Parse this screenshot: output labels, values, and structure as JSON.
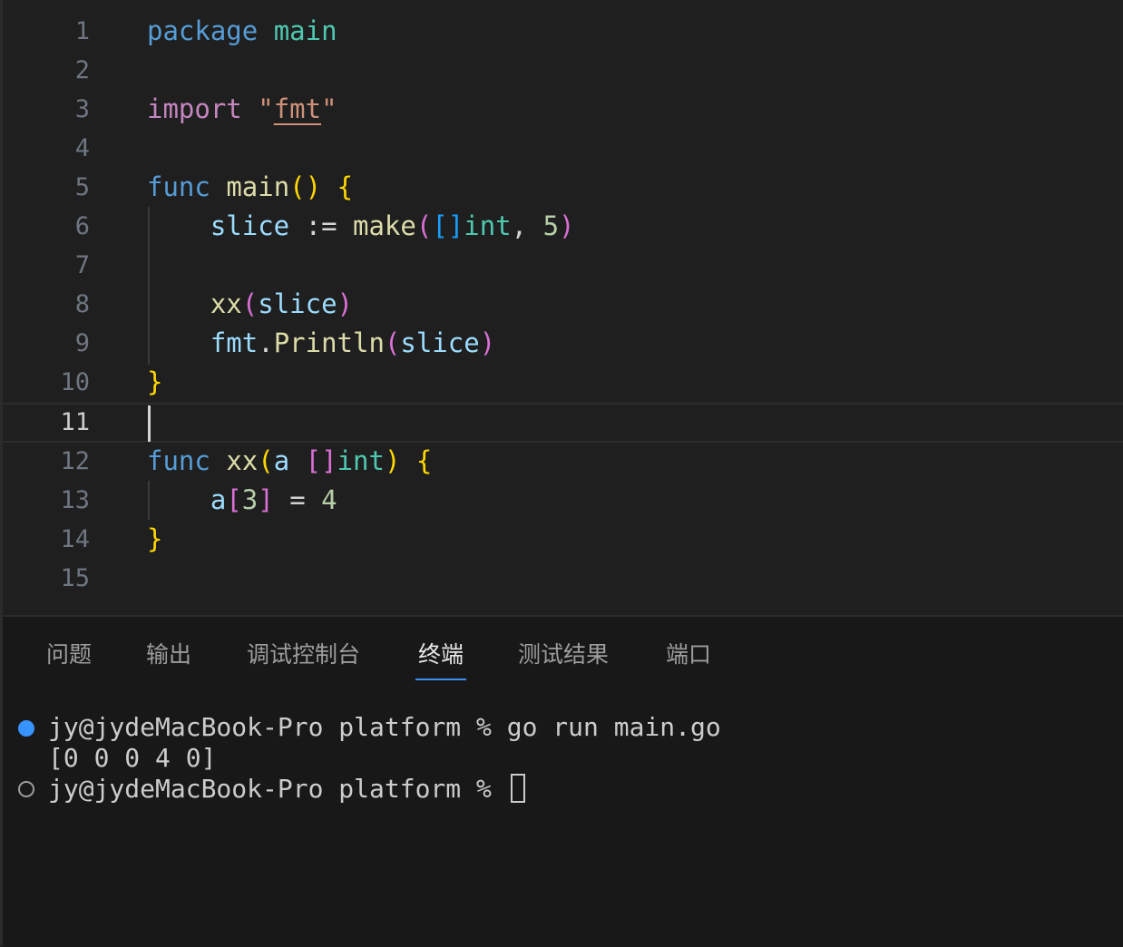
{
  "editor": {
    "line_numbers": [
      "1",
      "2",
      "3",
      "4",
      "5",
      "6",
      "7",
      "8",
      "9",
      "10",
      "11",
      "12",
      "13",
      "14",
      "15"
    ],
    "current_line": "11",
    "code": {
      "l1": {
        "kw": "package",
        "name": "main"
      },
      "l3": {
        "kw": "import",
        "q1": "\"",
        "str": "fmt",
        "q2": "\""
      },
      "l5": {
        "kw": "func",
        "name": "main",
        "open": "(",
        "close": ")",
        "brace": "{"
      },
      "l6": {
        "var": "slice",
        "op": ":=",
        "fn": "make",
        "open": "(",
        "brk": "[]",
        "type": "int",
        "comma": ",",
        "num": "5",
        "close": ")"
      },
      "l8": {
        "fn": "xx",
        "open": "(",
        "arg": "slice",
        "close": ")"
      },
      "l9": {
        "pkg": "fmt",
        "dot": ".",
        "fn": "Println",
        "open": "(",
        "arg": "slice",
        "close": ")"
      },
      "l10": {
        "brace": "}"
      },
      "l12": {
        "kw": "func",
        "name": "xx",
        "open": "(",
        "param": "a",
        "brk": "[]",
        "type": "int",
        "close": ")",
        "brace": "{"
      },
      "l13": {
        "var": "a",
        "brk_open": "[",
        "idx": "3",
        "brk_close": "]",
        "op": "=",
        "num": "4"
      },
      "l14": {
        "brace": "}"
      }
    }
  },
  "panel": {
    "tabs": [
      {
        "label": "问题"
      },
      {
        "label": "输出"
      },
      {
        "label": "调试控制台"
      },
      {
        "label": "终端"
      },
      {
        "label": "测试结果"
      },
      {
        "label": "端口"
      }
    ],
    "active_tab": "终端",
    "terminal": {
      "lines": [
        "jy@jydeMacBook-Pro platform % go run main.go",
        "[0 0 0 4 0]",
        "jy@jydeMacBook-Pro platform % "
      ]
    }
  },
  "colors": {
    "accent": "#3b8eea",
    "background": "#1f1f1f",
    "panel": "#181818"
  }
}
